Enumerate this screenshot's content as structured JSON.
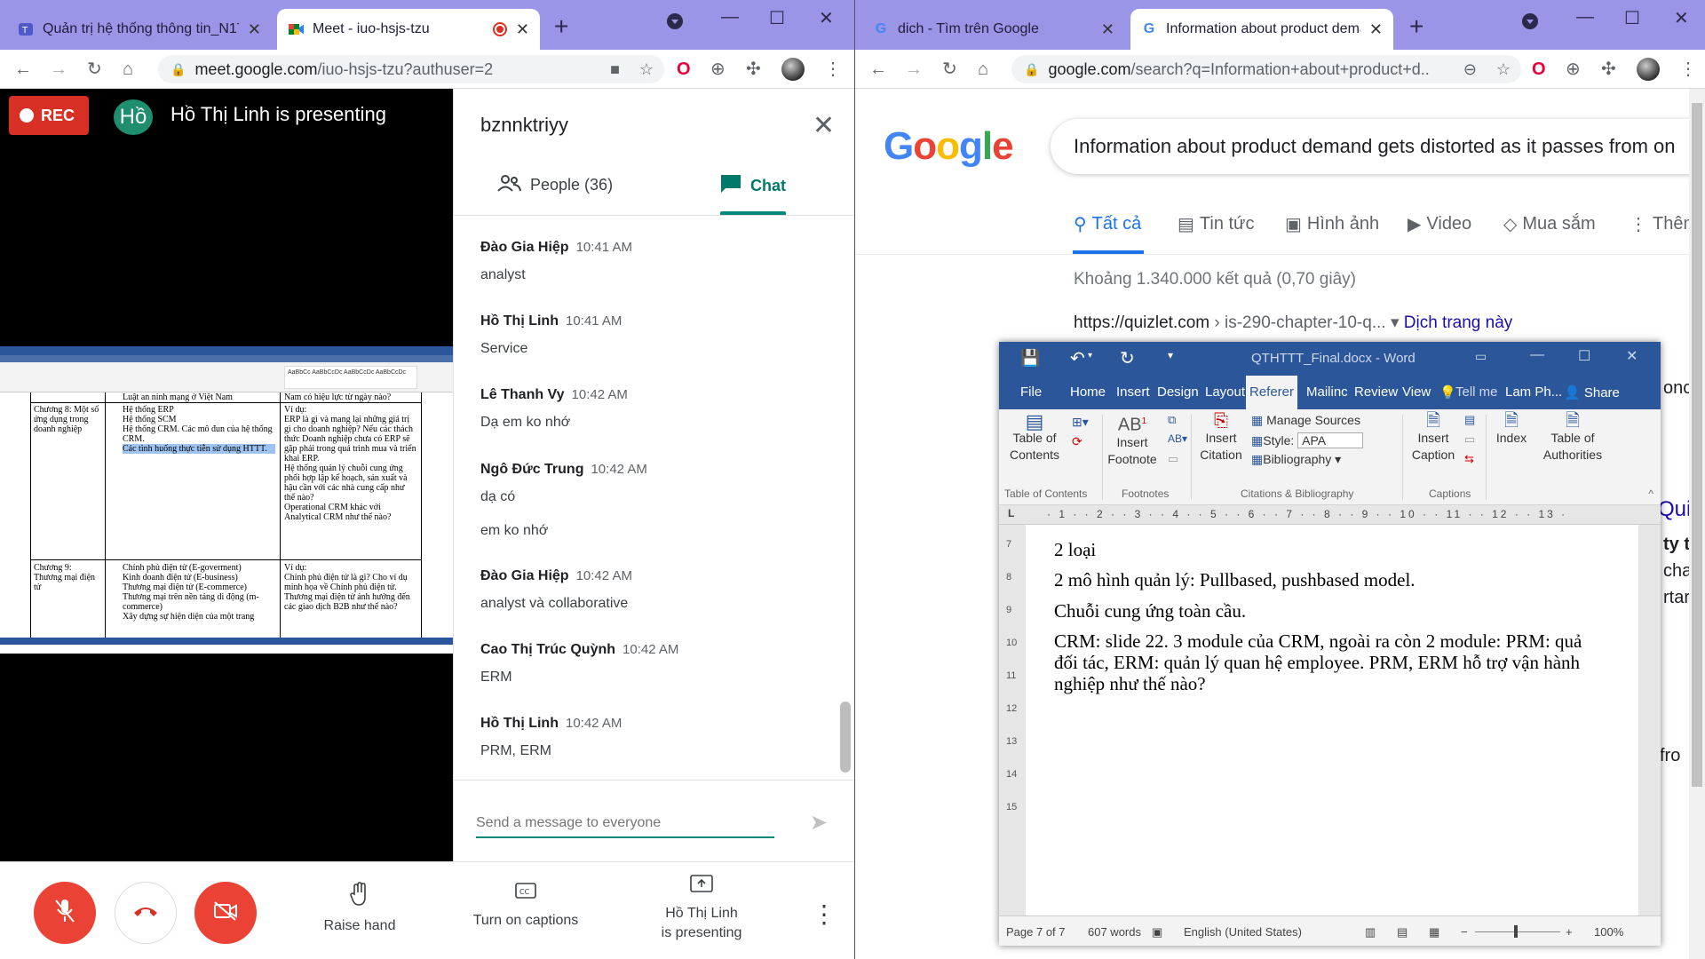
{
  "left_window": {
    "tabs": [
      {
        "title": "Quản trị hệ thống thông tin_N1T",
        "icon": "teams-icon"
      },
      {
        "title": "Meet - iuo-hsjs-tzu",
        "icon": "meet-icon",
        "recording": true
      }
    ],
    "url_host": "meet.google.com",
    "url_path": "/iuo-hsjs-tzu?authuser=2"
  },
  "meet": {
    "rec_label": "REC",
    "presenter_initial": "Hồ",
    "presenting_text": "Hồ Thị Linh is presenting",
    "meeting_code": "bznnktriyy",
    "people_tab": "People (36)",
    "chat_tab": "Chat",
    "messages": [
      {
        "name": "Đào Gia Hiệp",
        "time": "10:41 AM",
        "text": "analyst"
      },
      {
        "name": "Hồ Thị Linh",
        "time": "10:41 AM",
        "text": "Service"
      },
      {
        "name": "Lê Thanh Vy",
        "time": "10:42 AM",
        "text": "Dạ em ko nhớ"
      },
      {
        "name": "Ngô Đức Trung",
        "time": "10:42 AM",
        "text": "dạ có",
        "text2": "em ko nhớ"
      },
      {
        "name": "Đào Gia Hiệp",
        "time": "10:42 AM",
        "text": "analyst và collaborative"
      },
      {
        "name": "Cao Thị Trúc Quỳnh",
        "time": "10:42 AM",
        "text": "ERM"
      },
      {
        "name": "Hồ Thị Linh",
        "time": "10:42 AM",
        "text": "PRM, ERM"
      }
    ],
    "input_placeholder": "Send a message to everyone",
    "raise_hand": "Raise hand",
    "captions": "Turn on captions",
    "presenting_line1": "Hồ Thị Linh",
    "presenting_line2": "is presenting"
  },
  "shared_doc": {
    "row1_heading": "Luật an ninh mạng ở Việt Nam",
    "row1_right_heading": "Nam có hiệu lực từ ngày nào?",
    "chapter8": "Chương 8: Một số ứng dụng trong doanh nghiệp",
    "ch8_items": [
      "Hệ thống ERP",
      "Hệ thống SCM",
      "Hệ thống CRM. Các mô đun của hệ thống CRM.",
      "Các tình huống thực tiễn sử dụng HTTT."
    ],
    "ch8_examples_label": "Ví dụ:",
    "ch8_examples": [
      "ERP là gì và mang lại những giá trị gì cho doanh nghiệp? Nếu các thách thức Doanh nghiệp chưa có ERP sẽ gặp phải trong quá trình mua và triển khai ERP.",
      "Hệ thống quản lý chuỗi cung ứng phối hợp lập kế hoạch, sản xuất và hậu cần với các nhà cung cấp như thế nào?",
      "Operational CRM khác với Analytical CRM như thế nào?"
    ],
    "chapter9": "Chương 9: Thương mại điện tử",
    "ch9_items": [
      "Chính phủ điện tử (E-goverment)",
      "Kinh doanh điện tử (E-business)",
      "Thương mại điện tử (E-commerce)",
      "Thương mại trên nền tảng di động (m-commerce)",
      "Xây dựng sự hiện diện của một trang"
    ],
    "ch9_examples": [
      "Chính phủ điện tử là gì? Cho ví dụ minh họa về Chính phủ điện tử.",
      "Thương mại điện tử ảnh hưởng đến các giao dịch B2B như thế nào?"
    ]
  },
  "right_window": {
    "tabs": [
      {
        "title": "dich - Tìm trên Google"
      },
      {
        "title": "Information about product dema"
      }
    ],
    "url_host": "google.com",
    "url_path": "/search?q=Information+about+product+d..."
  },
  "google": {
    "query": "Information about product demand gets distorted as it passes from on",
    "tabs": [
      "Tất cả",
      "Tin tức",
      "Hình ảnh",
      "Video",
      "Mua sắm",
      "Thêm"
    ],
    "stats": "Khoảng 1.340.000 kết quả (0,70 giây)",
    "cite_host": "https://quizlet.com",
    "cite_path": "› is-290-chapter-10-q...",
    "translate": "Dịch trang này",
    "edge_snippets": [
      "onc",
      "Qui",
      "ty t",
      "cha",
      "rtar",
      "fro"
    ]
  },
  "word": {
    "title": "QTHTTT_Final.docx - Word",
    "menus": [
      "File",
      "Home",
      "Insert",
      "Design",
      "Layout",
      "Referer",
      "Mailinc",
      "Review",
      "View",
      "Tell me",
      "Lam Ph...",
      "Share"
    ],
    "ribbon": {
      "toc": "Table of Contents",
      "insert_footnote": "Insert Footnote",
      "insert_citation": "Insert Citation",
      "manage_sources": "Manage Sources",
      "style_label": "Style:",
      "style_value": "APA",
      "bibliography": "Bibliography",
      "insert_caption": "Insert Caption",
      "index": "Index",
      "toa": "Table of Authorities",
      "groups": [
        "Table of Contents",
        "Footnotes",
        "Citations & Bibliography",
        "Captions"
      ]
    },
    "lines": [
      "2 loại",
      "2 mô hình quản lý: Pullbased, pushbased model.",
      "Chuỗi cung ứng toàn cầu.",
      "CRM: slide 22. 3 module của CRM, ngoài ra còn 2 module: PRM: quả",
      "đối tác, ERM: quản lý quan hệ employee. PRM, ERM hỗ trợ vận hành",
      "nghiệp như thế nào?"
    ],
    "status": {
      "page": "Page 7 of 7",
      "words": "607 words",
      "lang": "English (United States)",
      "zoom": "100%"
    }
  }
}
